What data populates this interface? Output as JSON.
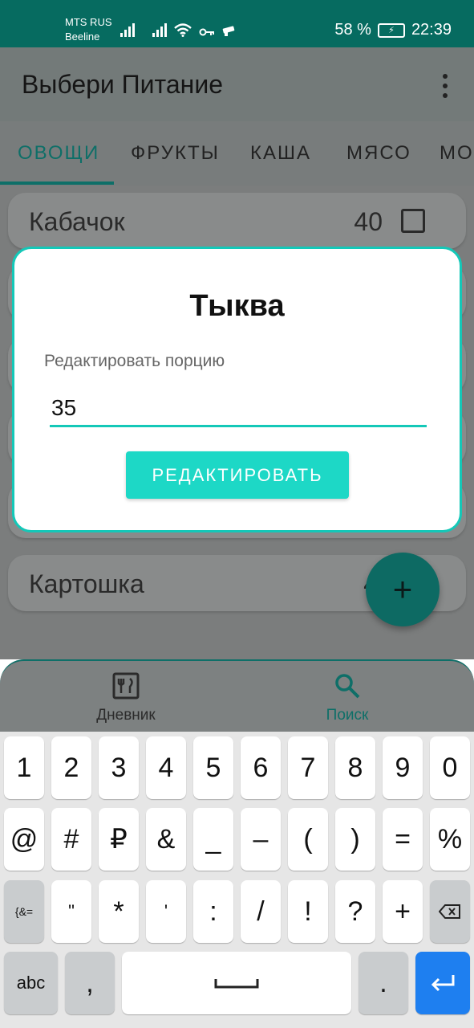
{
  "status_bar": {
    "carrier_1": "MTS RUS",
    "carrier_2": "Beeline",
    "battery": "58 %",
    "time": "22:39"
  },
  "app": {
    "title": "Выбери Питание"
  },
  "tabs": [
    "ОВОЩИ",
    "ФРУКТЫ",
    "КАША",
    "МЯСО",
    "МО"
  ],
  "list": {
    "items": [
      {
        "name": "Кабачок",
        "value": "40"
      },
      {
        "name": "Картошка",
        "value": "4"
      }
    ]
  },
  "fab": {
    "symbol": "+"
  },
  "bottom_nav": {
    "diary": "Дневник",
    "search": "Поиск"
  },
  "dialog": {
    "title": "Тыква",
    "label": "Редактировать порцию",
    "value": "35",
    "button": "РЕДАКТИРОВАТЬ"
  },
  "keyboard": {
    "row1": [
      "1",
      "2",
      "3",
      "4",
      "5",
      "6",
      "7",
      "8",
      "9",
      "0"
    ],
    "row2": [
      "@",
      "#",
      "₽",
      "&",
      "_",
      "–",
      "(",
      ")",
      "=",
      "%"
    ],
    "row3": [
      "{&=",
      "\"",
      "*",
      "'",
      ":",
      "/",
      "!",
      "?",
      "+"
    ],
    "abc": "abc",
    "comma": ",",
    "period": "."
  },
  "colors": {
    "accent": "#14c8b8",
    "primary_dark": "#066b60",
    "enter_key": "#1e7ff0"
  }
}
